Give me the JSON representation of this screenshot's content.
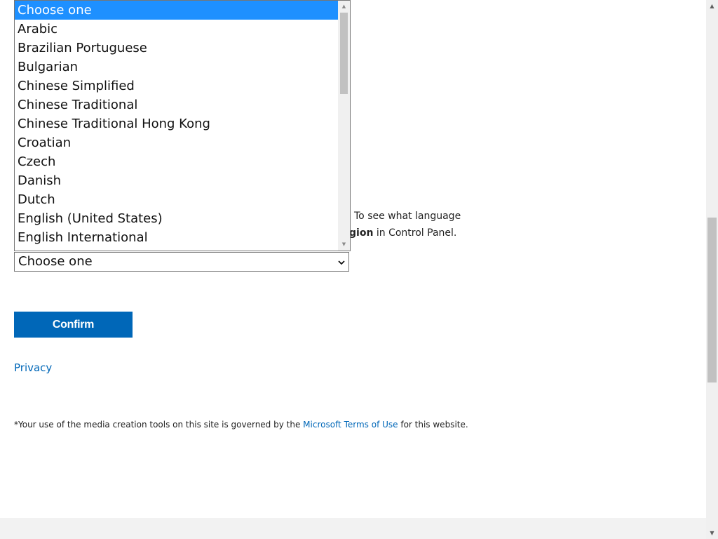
{
  "language_select": {
    "selected_value": "Choose one",
    "options": [
      "Choose one",
      "Arabic",
      "Brazilian Portuguese",
      "Bulgarian",
      "Chinese Simplified",
      "Chinese Traditional",
      "Chinese Traditional Hong Kong",
      "Croatian",
      "Czech",
      "Danish",
      "Dutch",
      "English (United States)",
      "English International"
    ],
    "highlighted_index": 0
  },
  "info_text": {
    "line1_visible": "To see what language",
    "line2_bold_fragment": "gion",
    "line2_rest": " in Control Panel."
  },
  "confirm_label": "Confirm",
  "privacy_label": "Privacy",
  "footnote": {
    "before": "*Your use of the media creation tools on this site is governed by the ",
    "link": "Microsoft Terms of Use",
    "after": " for this website."
  },
  "colors": {
    "accent": "#0067b8",
    "selection": "#1e90ff"
  }
}
